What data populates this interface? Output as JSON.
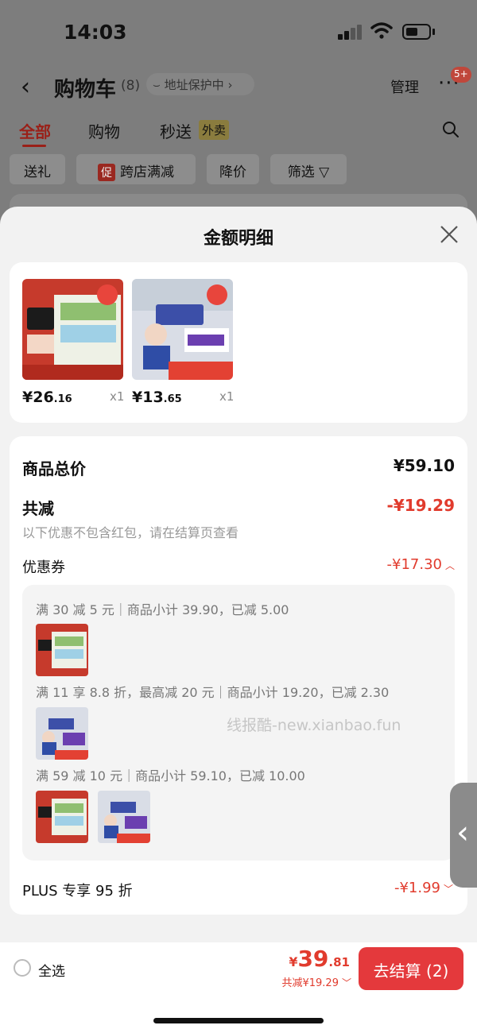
{
  "status_bar": {
    "time": "14:03"
  },
  "header": {
    "title": "购物车",
    "count": "(8)",
    "address_label": "地址保护中",
    "manage_label": "管理",
    "more_badge": "5+"
  },
  "tabs": [
    {
      "label": "全部"
    },
    {
      "label": "购物"
    },
    {
      "label": "秒送"
    }
  ],
  "takeout_tag": "外卖",
  "filters": [
    {
      "label": "送礼"
    },
    {
      "label": "跨店满减",
      "tag": "促"
    },
    {
      "label": "降价"
    },
    {
      "label": "筛选"
    }
  ],
  "sheet": {
    "title": "金额明细",
    "products": [
      {
        "price_int": "¥26",
        "price_dec": ".16",
        "qty": "x1"
      },
      {
        "price_int": "¥13",
        "price_dec": ".65",
        "qty": "x1"
      }
    ],
    "total_label": "商品总价",
    "total_value": "¥59.10",
    "discount_label": "共减",
    "discount_value": "-¥19.29",
    "discount_note": "以下优惠不包含红包，请在结算页查看",
    "coupon_label": "优惠券",
    "coupon_value": "-¥17.30",
    "rules": [
      "满 30 减 5 元｜商品小计 39.90，已减 5.00",
      "满 11 享 8.8 折，最高减 20 元｜商品小计 19.20，已减 2.30",
      "满 59 减 10 元｜商品小计 59.10，已减 10.00"
    ],
    "watermark": "线报酷-new.xianbao.fun",
    "plus_label": "PLUS 专享 95 折",
    "plus_value": "-¥1.99"
  },
  "bottom_bar": {
    "select_all_label": "全选",
    "total_currency": "¥",
    "total_int": "39",
    "total_dec": ".81",
    "saved_text": "共减¥19.29",
    "checkout_label": "去结算 (2)"
  },
  "colors": {
    "accent": "#e4393c",
    "discount_red": "#e13b2d"
  }
}
